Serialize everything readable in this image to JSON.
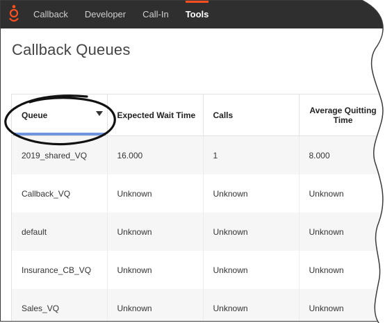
{
  "nav": {
    "items": [
      {
        "label": "Callback",
        "active": false
      },
      {
        "label": "Developer",
        "active": false
      },
      {
        "label": "Call-In",
        "active": false
      },
      {
        "label": "Tools",
        "active": true
      }
    ]
  },
  "page": {
    "title": "Callback Queues"
  },
  "table": {
    "columns": [
      "Queue",
      "Expected Wait Time",
      "Calls",
      "Average Quitting Time"
    ],
    "sort_column": "Queue",
    "rows": [
      [
        "2019_shared_VQ",
        "16.000",
        "1",
        "8.000"
      ],
      [
        "Callback_VQ",
        "Unknown",
        "Unknown",
        "Unknown"
      ],
      [
        "default",
        "Unknown",
        "Unknown",
        "Unknown"
      ],
      [
        "Insurance_CB_VQ",
        "Unknown",
        "Unknown",
        "Unknown"
      ],
      [
        "Sales_VQ",
        "Unknown",
        "Unknown",
        "Unknown"
      ]
    ]
  },
  "colors": {
    "topbar": "#2f2f2f",
    "accent": "#ff4f1f",
    "sort_indicator": "#6e95dd"
  },
  "icons": {
    "logo": "genesys-logo-icon",
    "sort": "sort-down-icon"
  }
}
